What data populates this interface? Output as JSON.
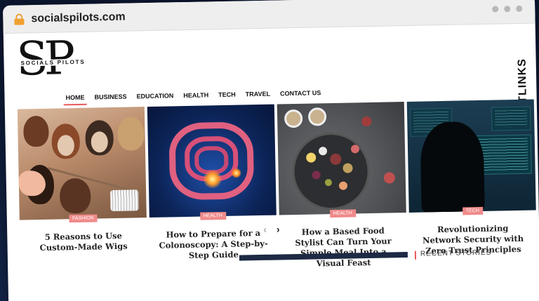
{
  "browser": {
    "url": "socialspilots.com"
  },
  "logo": {
    "letters": "SP",
    "tagline": "SOCIALS PILOTS"
  },
  "nav": {
    "items": [
      "HOME",
      "BUSINESS",
      "EDUCATION",
      "HEALTH",
      "TECH",
      "TRAVEL",
      "CONTACT US"
    ],
    "active": "HOME"
  },
  "side_brand": {
    "text": "GUESTPOSTLINKS"
  },
  "cards": [
    {
      "category": "FASHION",
      "title": "5 Reasons to Use Custom-Made Wigs"
    },
    {
      "category": "HEALTH",
      "title": "How to Prepare for a Colonoscopy: A Step-by-Step Guide"
    },
    {
      "category": "HEALTH",
      "title": "How a Based Food Stylist Can Turn Your Simple Meal Into a Visual Feast"
    },
    {
      "category": "TECH",
      "title": "Revolutionizing Network Security with Zero Trust Principles"
    }
  ],
  "pager": {
    "prev": "‹",
    "next": "›"
  },
  "sidebar": {
    "recent_heading": "RECENT STORIES"
  },
  "colors": {
    "accent": "#e85a5a",
    "badge": "#f08a8a",
    "lock": "#f0a030"
  },
  "icons": [
    "lock-icon",
    "search-icon",
    "chevron-left-icon",
    "chevron-right-icon",
    "guestpostlinks-logo-icon"
  ]
}
